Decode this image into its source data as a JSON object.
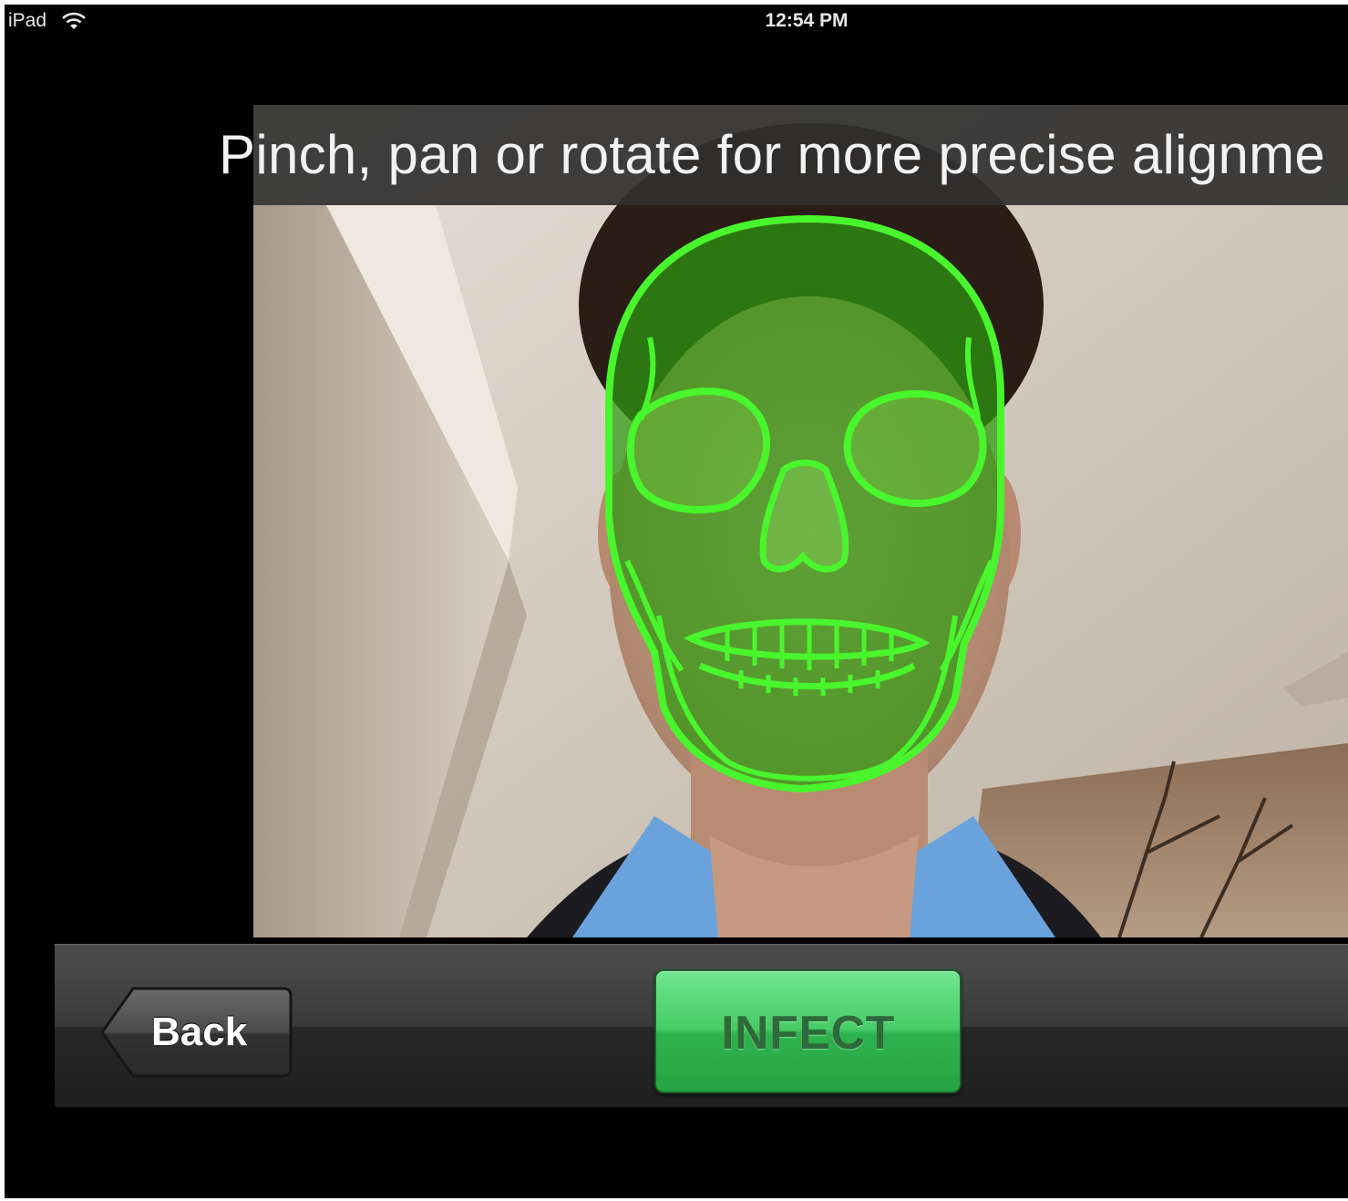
{
  "status_bar": {
    "carrier": "iPad",
    "time": "12:54 PM"
  },
  "instruction": {
    "text": "Pinch, pan or rotate for more precise alignme"
  },
  "overlay": {
    "name": "skull-overlay",
    "color": "#49f52c"
  },
  "toolbar": {
    "back_label": "Back",
    "action_label": "INFECT",
    "action_color": "#3cc05c"
  }
}
